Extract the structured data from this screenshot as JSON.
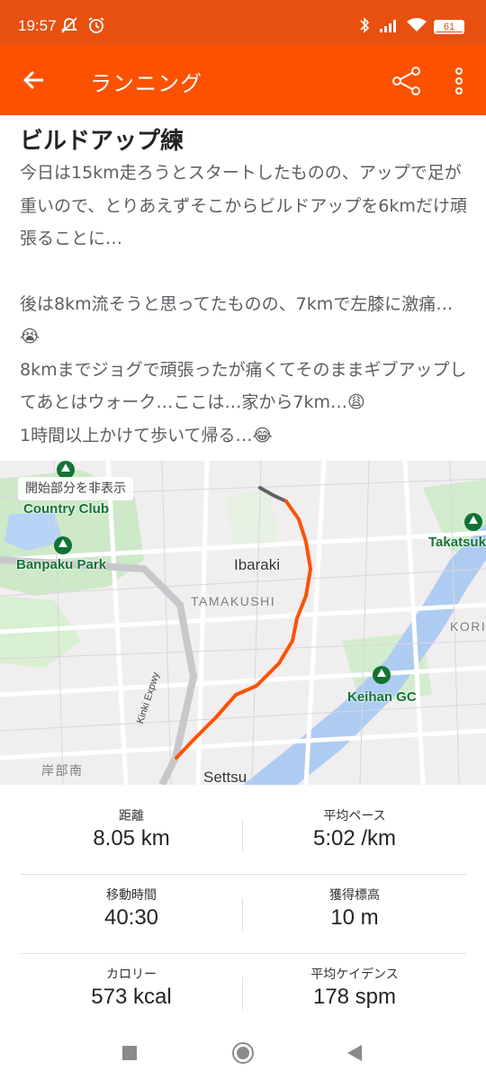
{
  "status_bar": {
    "time": "19:57",
    "battery": "61",
    "icons": [
      "mute-icon",
      "alarm-icon",
      "bluetooth-icon",
      "signal-icon",
      "wifi-icon",
      "battery-icon"
    ]
  },
  "app_bar": {
    "title": "ランニング",
    "back_icon": "arrow-left-icon",
    "share_icon": "share-icon",
    "more_icon": "more-vertical-icon"
  },
  "activity": {
    "title": "ビルドアップ練",
    "description": [
      "今日は15km走ろうとスタートしたものの、アップで足が重いので、とりあえずそこからビルドアップを6kmだけ頑張ることに…",
      "",
      "後は8km流そうと思ってたものの、7kmで左膝に激痛…😭",
      "8kmまでジョグで頑張ったが痛くてそのままギブアップしてあとはウォーク…ここは…家から7km…😩",
      "1時間以上かけて歩いて帰る…😂"
    ]
  },
  "map": {
    "toggle_label": "開始部分を非表示",
    "labels": {
      "country_club": "Country Club",
      "banpaku_park": "Banpaku Park",
      "ibaraki": "Ibaraki",
      "tamakushi": "TAMAKUSHI",
      "takatsuki": "Takatsuk",
      "kori": "KORI",
      "keihan_gc": "Keihan GC",
      "kinki_expwy": "Kinki Expwy",
      "kishibe_minami": "岸部南",
      "settsu": "Settsu"
    },
    "route_color": "#fc5200",
    "hidden_start_color": "#5f6368"
  },
  "stats": [
    {
      "left": {
        "label": "距離",
        "value": "8.05 km"
      },
      "right": {
        "label": "平均ペース",
        "value": "5:02 /km"
      }
    },
    {
      "left": {
        "label": "移動時間",
        "value": "40:30"
      },
      "right": {
        "label": "獲得標高",
        "value": "10 m"
      }
    },
    {
      "left": {
        "label": "カロリー",
        "value": "573 kcal"
      },
      "right": {
        "label": "平均ケイデンス",
        "value": "178 spm"
      }
    }
  ],
  "colors": {
    "accent": "#fc5200",
    "status_bar": "#e8500f",
    "text_primary": "#242428",
    "text_secondary": "#5d5d63"
  }
}
